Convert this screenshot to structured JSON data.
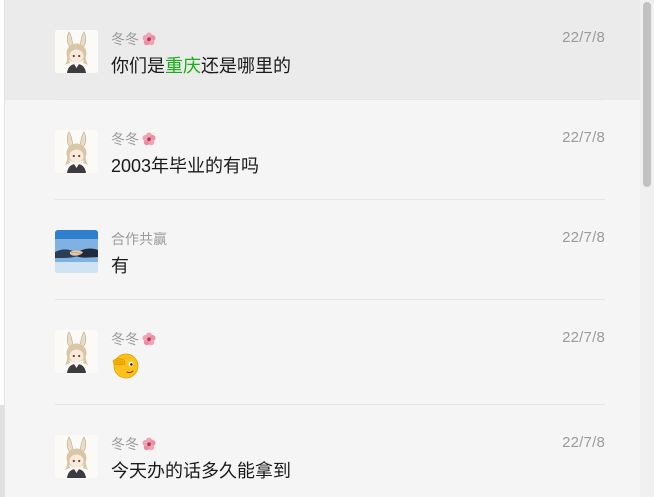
{
  "colors": {
    "background": "#f5f5f5",
    "highlight_row": "#ebebeb",
    "keyword_green": "#1aad19",
    "meta_grey": "#9b9b9b"
  },
  "messages": [
    {
      "sender": "冬冬",
      "sender_icon": "cherry-blossom-icon",
      "avatar": "anime-bunny-girl-avatar",
      "date": "22/7/8",
      "text_pre": "你们是",
      "text_highlight": "重庆",
      "text_post": "还是哪里的"
    },
    {
      "sender": "冬冬",
      "sender_icon": "cherry-blossom-icon",
      "avatar": "anime-bunny-girl-avatar",
      "date": "22/7/8",
      "text": "2003年毕业的有吗"
    },
    {
      "sender": "合作共赢",
      "avatar": "handshake-avatar",
      "date": "22/7/8",
      "text": "有"
    },
    {
      "sender": "冬冬",
      "sender_icon": "cherry-blossom-icon",
      "avatar": "anime-bunny-girl-avatar",
      "date": "22/7/8",
      "emoji": "facepalm-emoji-icon"
    },
    {
      "sender": "冬冬",
      "sender_icon": "cherry-blossom-icon",
      "avatar": "anime-bunny-girl-avatar",
      "date": "22/7/8",
      "text": "今天办的话多久能拿到"
    }
  ]
}
